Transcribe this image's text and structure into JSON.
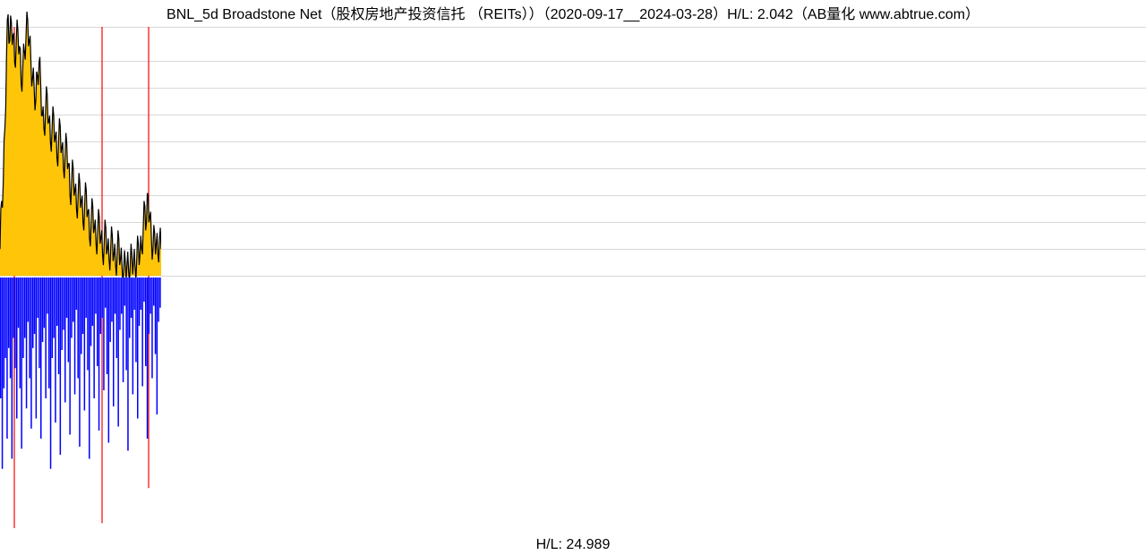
{
  "title": "BNL_5d Broadstone Net（股权房地产投资信托 （REITs））（2020-09-17__2024-03-28）H/L: 2.042（AB量化  www.abtrue.com）",
  "footer": "H/L: 24.989",
  "chart_data": {
    "type": "area",
    "ticker": "BNL",
    "name": "Broadstone Net",
    "sector": "股权房地产投资信托 （REITs）",
    "date_range": [
      "2020-09-17",
      "2024-03-28"
    ],
    "price_hl_ratio": 2.042,
    "volume_hl_ratio": 24.989,
    "grid_count": 10,
    "data_region_x_fraction": 0.14,
    "red_spike_x_positions": [
      16,
      114,
      166
    ],
    "price_series_norm": [
      0.1,
      0.28,
      0.35,
      0.55,
      0.82,
      0.98,
      0.88,
      0.95,
      0.9,
      0.8,
      0.88,
      0.92,
      0.86,
      0.72,
      0.78,
      0.84,
      0.9,
      0.96,
      0.88,
      0.8,
      0.74,
      0.7,
      0.66,
      0.75,
      0.8,
      0.72,
      0.6,
      0.55,
      0.62,
      0.68,
      0.58,
      0.5,
      0.55,
      0.6,
      0.52,
      0.44,
      0.5,
      0.56,
      0.48,
      0.4,
      0.45,
      0.5,
      0.42,
      0.3,
      0.35,
      0.4,
      0.32,
      0.25,
      0.3,
      0.35,
      0.28,
      0.2,
      0.26,
      0.32,
      0.24,
      0.14,
      0.2,
      0.26,
      0.18,
      0.12,
      0.16,
      0.22,
      0.14,
      0.08,
      0.12,
      0.18,
      0.1,
      0.06,
      0.1,
      0.15,
      0.08,
      0.04,
      0.08,
      0.14,
      0.06,
      0.03,
      0.02,
      0.05,
      0.04,
      0.02,
      0.04,
      0.08,
      0.05,
      0.03,
      0.06,
      0.12,
      0.08,
      0.1,
      0.18,
      0.26,
      0.2,
      0.3,
      0.22,
      0.14,
      0.1,
      0.16,
      0.12,
      0.08,
      0.14,
      0.1
    ],
    "volume_series_norm": [
      0.6,
      0.95,
      0.55,
      0.4,
      0.8,
      0.35,
      0.5,
      0.9,
      0.3,
      0.45,
      0.7,
      0.25,
      0.55,
      0.85,
      0.4,
      0.3,
      0.65,
      0.22,
      0.5,
      0.75,
      0.35,
      0.28,
      0.7,
      0.2,
      0.45,
      0.8,
      0.32,
      0.25,
      0.6,
      0.18,
      0.55,
      0.95,
      0.4,
      0.3,
      0.72,
      0.24,
      0.48,
      0.88,
      0.36,
      0.26,
      0.62,
      0.2,
      0.42,
      0.78,
      0.3,
      0.22,
      0.58,
      0.16,
      0.5,
      0.84,
      0.38,
      0.28,
      0.66,
      0.2,
      0.46,
      0.9,
      0.34,
      0.24,
      0.6,
      0.18,
      0.44,
      0.76,
      0.28,
      0.2,
      0.56,
      0.15,
      0.48,
      0.82,
      0.32,
      0.22,
      0.64,
      0.18,
      0.4,
      0.74,
      0.26,
      0.18,
      0.52,
      0.14,
      0.46,
      0.86,
      0.3,
      0.2,
      0.58,
      0.16,
      0.42,
      0.7,
      0.24,
      0.16,
      0.54,
      0.12,
      0.44,
      0.8,
      0.28,
      0.18,
      0.5,
      0.14,
      0.38,
      0.68,
      0.22,
      0.15
    ],
    "colors": {
      "price_fill": "#FFC508",
      "price_stroke": "#000000",
      "volume_fill": "#0000FF",
      "spike": "#FF0000",
      "grid": "#d8d8d8"
    }
  }
}
